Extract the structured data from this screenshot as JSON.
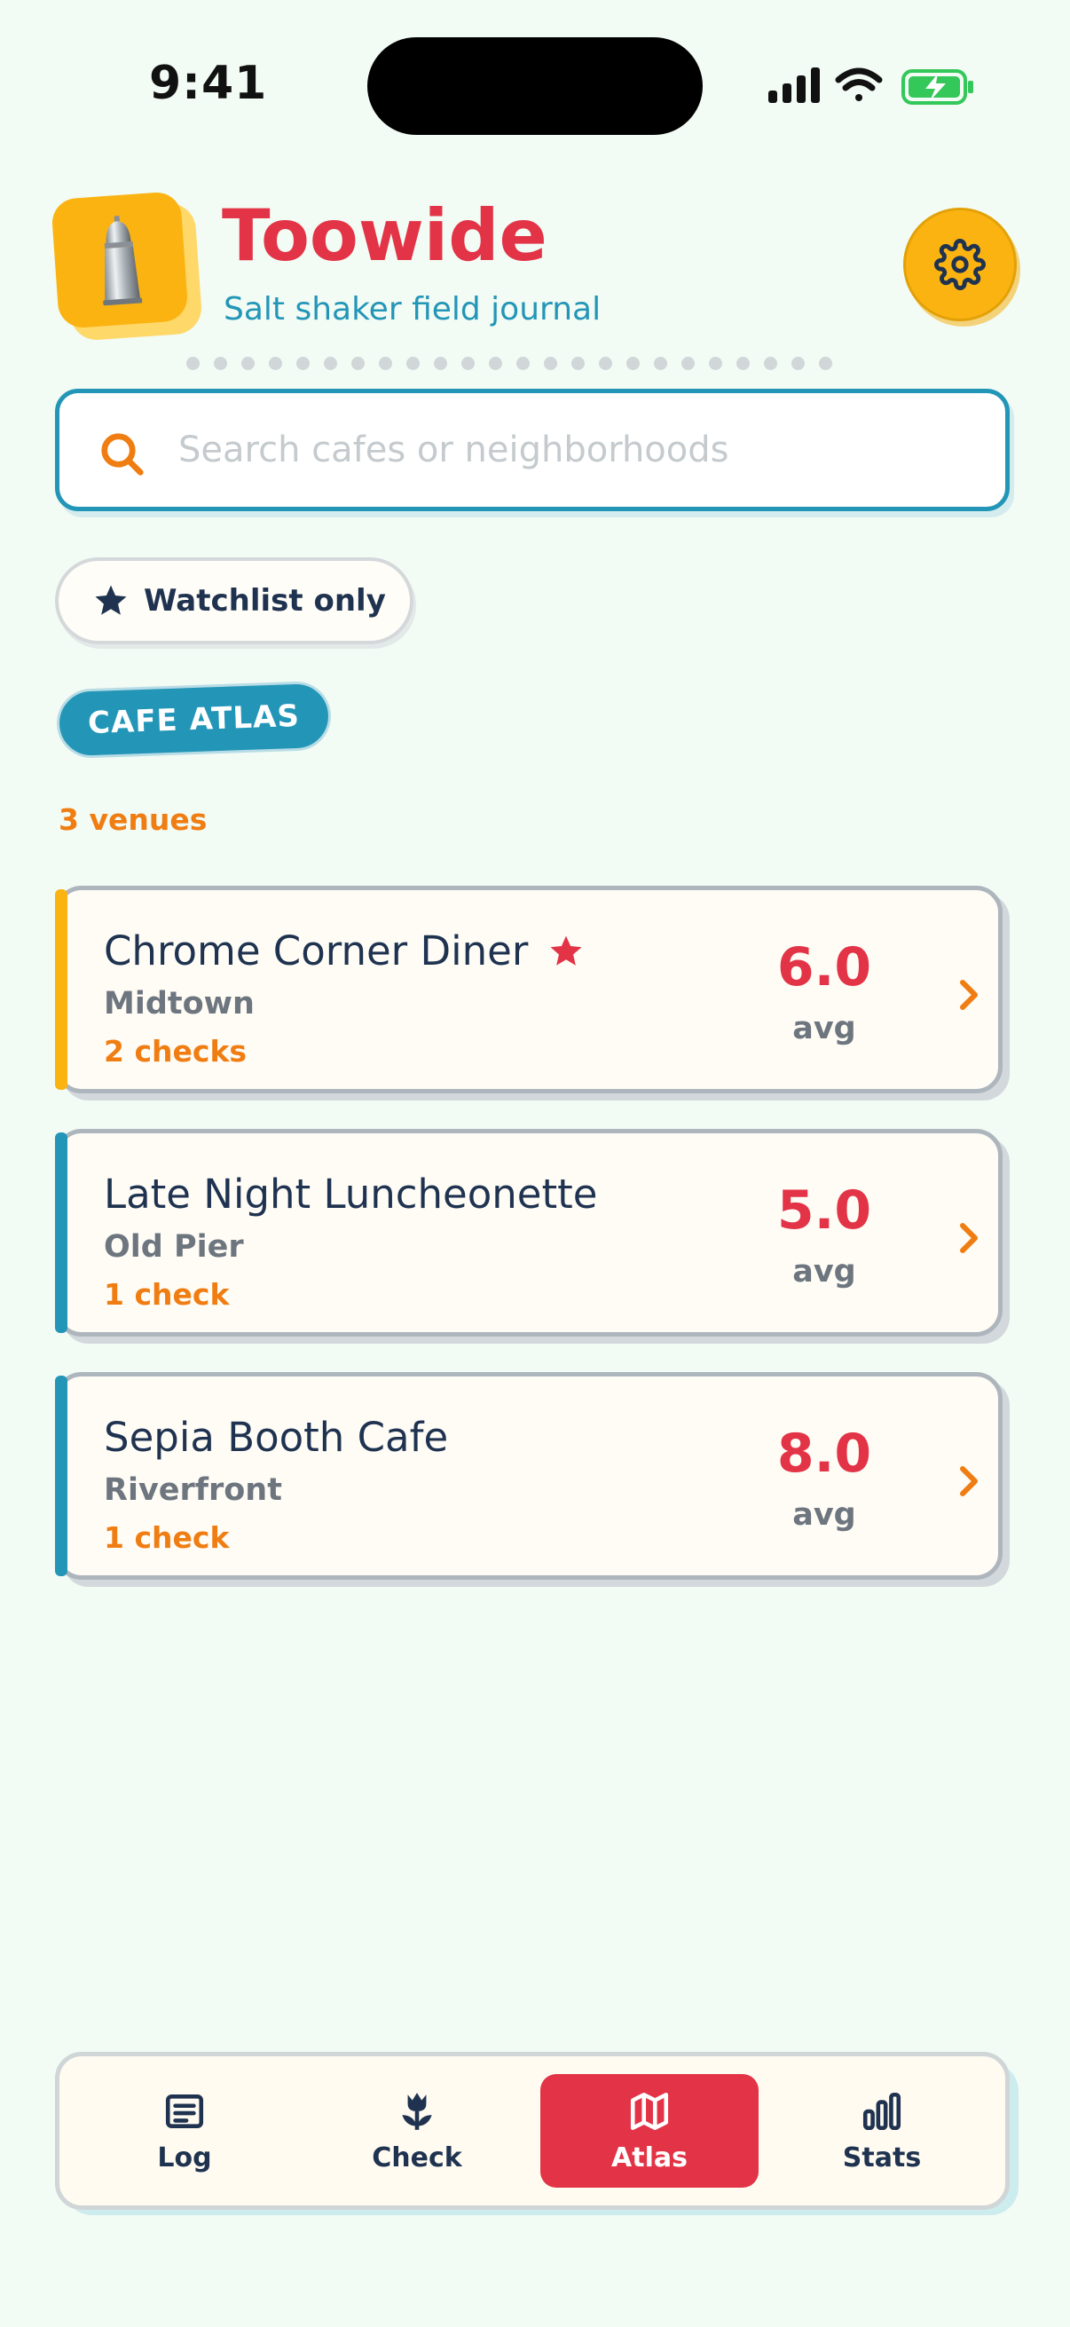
{
  "status_bar": {
    "time": "9:41"
  },
  "header": {
    "title": "Toowide",
    "subtitle": "Salt shaker field journal",
    "logo_icon": "salt-shaker-icon",
    "settings_icon": "gear-icon"
  },
  "search": {
    "placeholder": "Search cafes or neighborhoods",
    "value": ""
  },
  "filter": {
    "watchlist_label": "Watchlist only"
  },
  "section": {
    "badge": "CAFE ATLAS",
    "count_text": "3 venues"
  },
  "venues": [
    {
      "name": "Chrome Corner Diner",
      "neighborhood": "Midtown",
      "checks": "2 checks",
      "score": "6.0",
      "score_label": "avg",
      "watchlisted": true,
      "accent": "#fbb312"
    },
    {
      "name": "Late Night Luncheonette",
      "neighborhood": "Old Pier",
      "checks": "1 check",
      "score": "5.0",
      "score_label": "avg",
      "watchlisted": false,
      "accent": "#2396b8"
    },
    {
      "name": "Sepia Booth Cafe",
      "neighborhood": "Riverfront",
      "checks": "1 check",
      "score": "8.0",
      "score_label": "avg",
      "watchlisted": false,
      "accent": "#2396b8"
    }
  ],
  "tabs": [
    {
      "label": "Log",
      "icon": "list-icon",
      "active": false
    },
    {
      "label": "Check",
      "icon": "tulip-icon",
      "active": false
    },
    {
      "label": "Atlas",
      "icon": "map-icon",
      "active": true
    },
    {
      "label": "Stats",
      "icon": "bar-chart-icon",
      "active": false
    }
  ],
  "colors": {
    "background": "#f2fbf4",
    "brand_red": "#e23446",
    "brand_yellow": "#fbb312",
    "teal": "#2396b8",
    "orange": "#f07d12",
    "navy": "#1f3350"
  }
}
